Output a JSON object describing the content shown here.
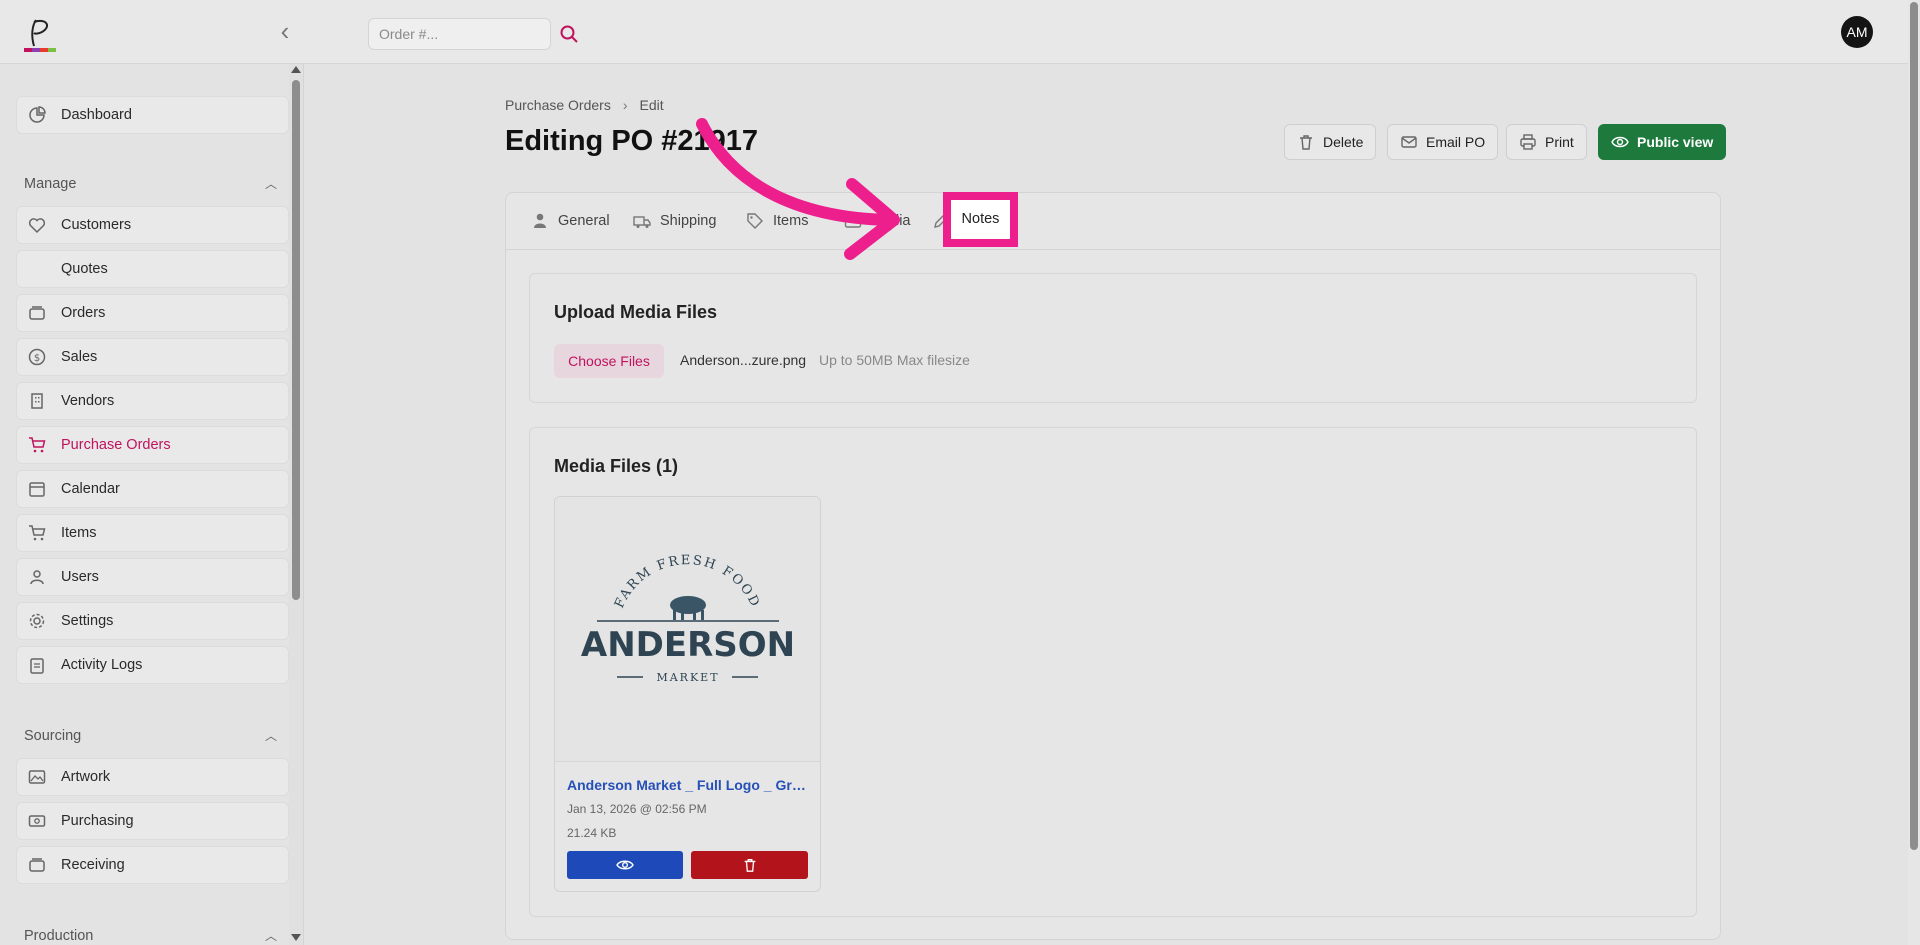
{
  "topbar": {
    "search_placeholder": "Order #...",
    "avatar_initials": "AM"
  },
  "sidebar": {
    "dashboard": "Dashboard",
    "sections": [
      {
        "title": "Manage",
        "items": [
          "Customers",
          "Quotes",
          "Orders",
          "Sales",
          "Vendors",
          "Purchase Orders",
          "Calendar",
          "Items",
          "Users",
          "Settings",
          "Activity Logs"
        ]
      },
      {
        "title": "Sourcing",
        "items": [
          "Artwork",
          "Purchasing",
          "Receiving"
        ]
      },
      {
        "title": "Production",
        "items": []
      }
    ],
    "active_item": "Purchase Orders",
    "active_color": "#c0125f"
  },
  "header": {
    "breadcrumb": [
      "Purchase Orders",
      "Edit"
    ],
    "title": "Editing PO #21917",
    "buttons": {
      "delete": "Delete",
      "email": "Email PO",
      "print": "Print",
      "public": "Public view"
    }
  },
  "tabs": [
    "General",
    "Shipping",
    "Items",
    "Media",
    "Notes"
  ],
  "upload": {
    "title": "Upload Media Files",
    "choose_label": "Choose Files",
    "file_name": "Anderson...zure.png",
    "hint": "Up to 50MB Max filesize"
  },
  "media": {
    "title": "Media Files (1)",
    "file": {
      "name": "Anderson Market _ Full Logo _ Grey ...",
      "date": "Jan 13, 2026 @ 02:56 PM",
      "size": "21.24 KB",
      "logo_top": "FARM FRESH FOOD",
      "logo_main": "ANDERSON",
      "logo_sub": "MARKET"
    }
  },
  "annotation": {
    "highlight_label": "Notes",
    "color": "#ec1f8d"
  }
}
